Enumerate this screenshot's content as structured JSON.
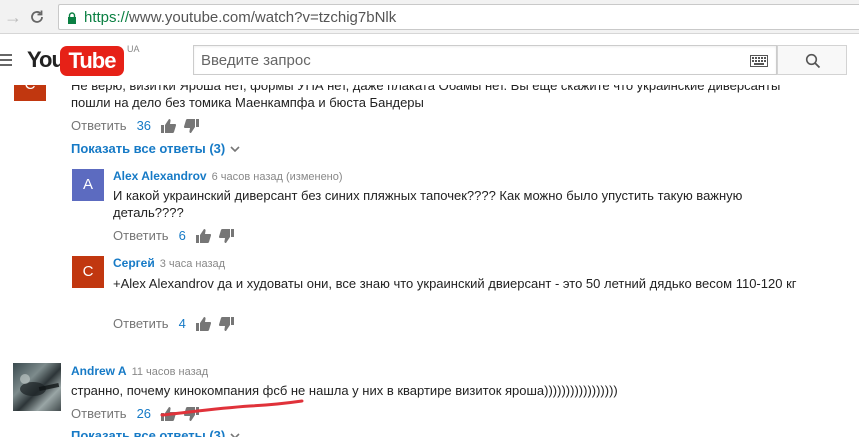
{
  "browser": {
    "url_scheme": "https://",
    "url_rest": "www.youtube.com/watch?v=tzchig7bNlk"
  },
  "masthead": {
    "logo_you": "You",
    "logo_tube": "Tube",
    "region": "UA",
    "search_placeholder": "Введите запрос"
  },
  "comments": {
    "top": {
      "avatar_letter": "С",
      "avatar_color": "#c1370f",
      "text": "Не верю, визитки Яроша нет, формы УПА нет, даже плаката Обамы нет. Вы еще скажите что украинские диверсанты пошли на дело без томика Маенкампфа и бюста Бандеры",
      "reply_label": "Ответить",
      "likes": "36",
      "show_replies": "Показать все ответы (3)"
    },
    "replies": [
      {
        "avatar_letter": "A",
        "avatar_color": "#5c6bc0",
        "author": "Alex Alexandrov",
        "meta": "6 часов назад (изменено)",
        "text": "И какой украинский диверсант без синих пляжных тапочек???? Как можно было упустить такую важную деталь????",
        "reply_label": "Ответить",
        "likes": "6"
      },
      {
        "avatar_letter": "С",
        "avatar_color": "#c1370f",
        "author": "Сергей",
        "meta": "3 часа назад",
        "text": "+Alex Alexandrov да и худоваты они,  все знаю что украинский двиерсант - это 50 летний дядько весом 110-120 кг",
        "reply_label": "Ответить",
        "likes": "4"
      }
    ],
    "second": {
      "author": "Andrew A",
      "meta": "11 часов назад",
      "text": "странно, почему кинокомпания фсб не нашла у них в квартире визиток яроша)))))))))))))))))",
      "reply_label": "Ответить",
      "likes": "26",
      "show_replies": "Показать все ответы (3)"
    }
  },
  "colors": {
    "link": "#167ac6",
    "youtube_red": "#e62117",
    "annotation_red": "#e0323a"
  }
}
